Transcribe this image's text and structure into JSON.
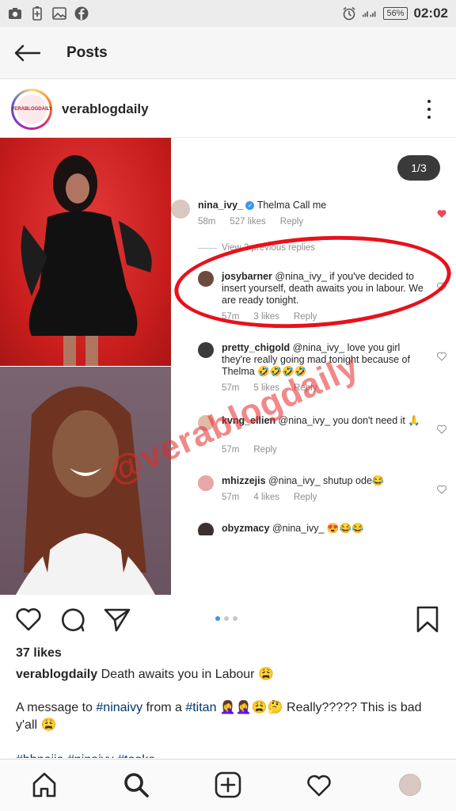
{
  "status_bar": {
    "battery": "56%",
    "time": "02:02"
  },
  "header": {
    "title": "Posts"
  },
  "post": {
    "username": "verablogdaily",
    "avatar_text": "VERABLOGDAILY",
    "slide_counter": "1/3",
    "comments": [
      {
        "user": "nina_ivy_",
        "verified": true,
        "text": "Thelma Call me",
        "time": "58m",
        "likes": "527 likes",
        "reply": "Reply",
        "liked": true
      },
      {
        "user": "josybarner",
        "text": "@nina_ivy_ if you've decided to insert  yourself,  death awaits you in labour.  We are ready tonight.",
        "time": "57m",
        "likes": "3 likes",
        "reply": "Reply"
      },
      {
        "user": "pretty_chigold",
        "text": "@nina_ivy_ love you girl they're really going mad tonight because of Thelma 🤣🤣🤣🤣",
        "time": "57m",
        "likes": "5 likes",
        "reply": "Reply"
      },
      {
        "user": "kvng_ellien",
        "text": "@nina_ivy_  you don't need it 🙏",
        "time": "57m",
        "likes": "",
        "reply": "Reply"
      },
      {
        "user": "mhizzejis",
        "text": "@nina_ivy_ shutup ode😂",
        "time": "57m",
        "likes": "4 likes",
        "reply": "Reply"
      },
      {
        "user": "obyzmacy",
        "text": "@nina_ivy_ 😍😂😂",
        "time": "",
        "likes": "",
        "reply": ""
      }
    ],
    "view_previous": "View 2 previous replies",
    "watermark": "@verablogdaily",
    "likes": "37 likes",
    "caption_user": "verablogdaily",
    "caption_text": "Death awaits you in Labour 😩",
    "caption_line2_prefix": "A message to ",
    "caption_tag1": "#ninaivy",
    "caption_line2_mid": " from a ",
    "caption_tag2": "#titan",
    "caption_line2_suffix": " 🤦‍♀️🤦‍♀️😩🤔 Really????? This is bad y'all 😩",
    "caption_line3": "#bbnaija #ninaivy #tooke"
  },
  "colors": {
    "accent": "#3897f0",
    "annotation_red": "#e8111b",
    "heart_red": "#ed4956"
  }
}
